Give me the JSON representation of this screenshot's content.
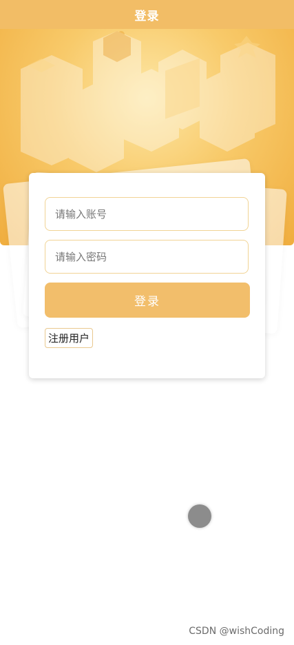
{
  "navbar": {
    "title": "登录"
  },
  "login_form": {
    "account_placeholder": "请输入账号",
    "password_placeholder": "请输入密码",
    "login_button_label": "登录",
    "register_button_label": "注册用户"
  },
  "watermark": {
    "text": "CSDN @wishCoding"
  },
  "colors": {
    "navbar_bg": "#f2bd66",
    "hero_accent": "#f0ad3e",
    "login_button_bg": "#f2be6b",
    "input_border": "#f1d394"
  }
}
